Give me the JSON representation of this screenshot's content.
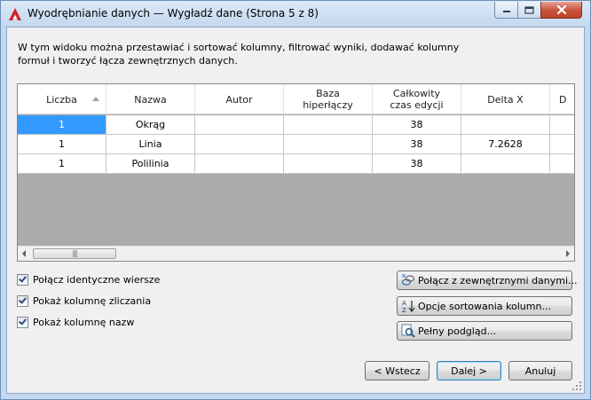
{
  "window": {
    "title": "Wyodrębnianie danych — Wygładź dane (Strona 5 z 8)",
    "icons": {
      "app": "autocad-a-icon",
      "minimize": "minimize-icon",
      "maximize": "maximize-icon",
      "close": "close-icon"
    }
  },
  "description": "W tym widoku można przestawiać i sortować kolumny, filtrować wyniki, dodawać kolumny formuł i tworzyć łącza zewnętrznych danych.",
  "grid": {
    "columns": [
      "Liczba",
      "Nazwa",
      "Autor",
      "Baza\nhiperłączy",
      "Całkowity\nczas edycji",
      "Delta X",
      "D"
    ],
    "sorted_column": "Liczba",
    "rows": [
      [
        "1",
        "Okrąg",
        "",
        "",
        "38",
        "",
        ""
      ],
      [
        "1",
        "Linia",
        "",
        "",
        "38",
        "7.2628",
        ""
      ],
      [
        "1",
        "Polilinia",
        "",
        "",
        "38",
        "",
        ""
      ]
    ],
    "scroll_grip": "|||"
  },
  "options": {
    "combine_identical": {
      "label": "Połącz identyczne wiersze",
      "checked": true
    },
    "show_count": {
      "label": "Pokaż kolumnę zliczania",
      "checked": true
    },
    "show_name": {
      "label": "Pokaż kolumnę nazw",
      "checked": true
    }
  },
  "actions": {
    "link_external": "Połącz z zewnętrznymi danymi...",
    "sort_options": "Opcje sortowania kolumn...",
    "full_preview": "Pełny podgląd..."
  },
  "nav": {
    "back": "< Wstecz",
    "next": "Dalej >",
    "cancel": "Anuluj"
  },
  "colors": {
    "selection": "#3399ff",
    "grid_background": "#ababab",
    "title_bar": "#c3d8ee",
    "close_button": "#c8513a"
  }
}
